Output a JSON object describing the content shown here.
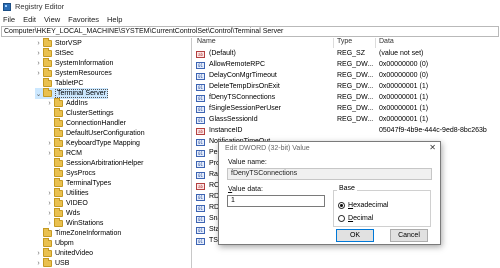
{
  "window": {
    "title": "Registry Editor",
    "colors": {
      "selection": "#cce8ff",
      "folder": "#e9c04f"
    }
  },
  "menu": [
    "File",
    "Edit",
    "View",
    "Favorites",
    "Help"
  ],
  "address": "Computer\\HKEY_LOCAL_MACHINE\\SYSTEM\\CurrentControlSet\\Control\\Terminal Server",
  "tree": [
    {
      "label": "StorVSP",
      "depth": 0,
      "expander": ">"
    },
    {
      "label": "StSec",
      "depth": 0,
      "expander": ">"
    },
    {
      "label": "SystemInformation",
      "depth": 0,
      "expander": ">"
    },
    {
      "label": "SystemResources",
      "depth": 0,
      "expander": ">"
    },
    {
      "label": "TabletPC",
      "depth": 0,
      "expander": ""
    },
    {
      "label": "Terminal Server",
      "depth": 0,
      "expander": "v",
      "selected": true
    },
    {
      "label": "AddIns",
      "depth": 1,
      "expander": ">"
    },
    {
      "label": "ClusterSettings",
      "depth": 1,
      "expander": ""
    },
    {
      "label": "ConnectionHandler",
      "depth": 1,
      "expander": ""
    },
    {
      "label": "DefaultUserConfiguration",
      "depth": 1,
      "expander": ""
    },
    {
      "label": "KeyboardType Mapping",
      "depth": 1,
      "expander": ">"
    },
    {
      "label": "RCM",
      "depth": 1,
      "expander": ">"
    },
    {
      "label": "SessionArbitrationHelper",
      "depth": 1,
      "expander": ""
    },
    {
      "label": "SysProcs",
      "depth": 1,
      "expander": ""
    },
    {
      "label": "TerminalTypes",
      "depth": 1,
      "expander": ""
    },
    {
      "label": "Utilities",
      "depth": 1,
      "expander": ">"
    },
    {
      "label": "VIDEO",
      "depth": 1,
      "expander": ">"
    },
    {
      "label": "Wds",
      "depth": 1,
      "expander": ">"
    },
    {
      "label": "WinStations",
      "depth": 1,
      "expander": ">"
    },
    {
      "label": "TimeZoneInformation",
      "depth": 0,
      "expander": ""
    },
    {
      "label": "Ubpm",
      "depth": 0,
      "expander": ""
    },
    {
      "label": "UnitedVideo",
      "depth": 0,
      "expander": ">"
    },
    {
      "label": "USB",
      "depth": 0,
      "expander": ">"
    }
  ],
  "list": {
    "headers": {
      "name": "Name",
      "type": "Type",
      "data": "Data"
    },
    "rows": [
      {
        "icon": "ab",
        "name": "(Default)",
        "type": "REG_SZ",
        "data": "(value not set)"
      },
      {
        "icon": "bin",
        "name": "AllowRemoteRPC",
        "type": "REG_DW...",
        "data": "0x00000000 (0)"
      },
      {
        "icon": "bin",
        "name": "DelayConMgrTimeout",
        "type": "REG_DW...",
        "data": "0x00000000 (0)"
      },
      {
        "icon": "bin",
        "name": "DeleteTempDirsOnExit",
        "type": "REG_DW...",
        "data": "0x00000001 (1)"
      },
      {
        "icon": "bin",
        "name": "fDenyTSConnections",
        "type": "REG_DW...",
        "data": "0x00000001 (1)"
      },
      {
        "icon": "bin",
        "name": "fSingleSessionPerUser",
        "type": "REG_DW...",
        "data": "0x00000001 (1)"
      },
      {
        "icon": "bin",
        "name": "GlassSessionId",
        "type": "REG_DW...",
        "data": "0x00000001 (1)"
      },
      {
        "icon": "ab",
        "name": "InstanceID",
        "type": "",
        "data": "05047f9-4b9e-444c-9ed8-8bc263b"
      },
      {
        "icon": "bin",
        "name": "NotificationTimeOut",
        "type": "",
        "data": ""
      },
      {
        "icon": "bin",
        "name": "PerSe",
        "type": "",
        "data": ""
      },
      {
        "icon": "bin",
        "name": "Produ",
        "type": "",
        "data": ""
      },
      {
        "icon": "bin",
        "name": "RailS",
        "type": "",
        "data": ""
      },
      {
        "icon": "ab",
        "name": "RCDe",
        "type": "",
        "data": "essionEnv"
      },
      {
        "icon": "bin",
        "name": "RDPV",
        "type": "",
        "data": ""
      },
      {
        "icon": "bin",
        "name": "RDPV",
        "type": "",
        "data": ""
      },
      {
        "icon": "bin",
        "name": "Snaps",
        "type": "",
        "data": ""
      },
      {
        "icon": "bin",
        "name": "StartR",
        "type": "",
        "data": ""
      },
      {
        "icon": "bin",
        "name": "TSUse",
        "type": "",
        "data": ""
      }
    ]
  },
  "dialog": {
    "title": "Edit DWORD (32-bit) Value",
    "close": "✕",
    "value_name_label": "Value name:",
    "value_name": "fDenyTSConnections",
    "value_data_label": "Value data:",
    "value_data": "1",
    "base_label": "Base",
    "hex_label": "Hexadecimal",
    "dec_label": "Decimal",
    "base_selected": "Hexadecimal",
    "ok_label": "OK",
    "cancel_label": "Cancel"
  }
}
